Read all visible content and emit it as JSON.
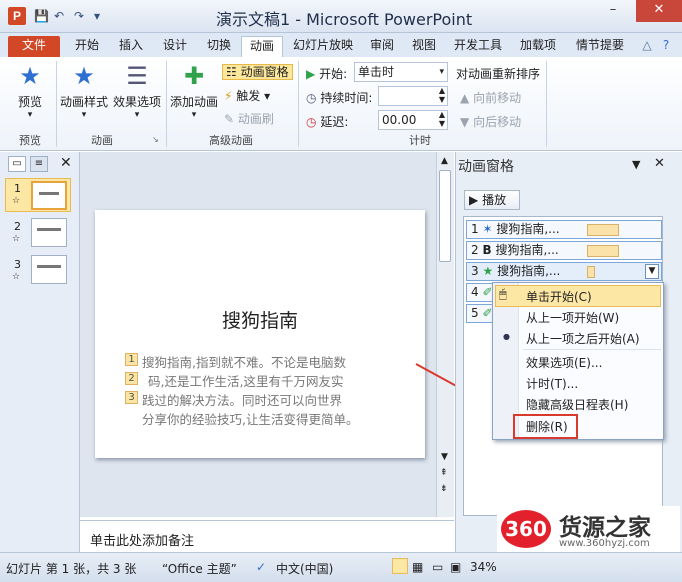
{
  "titlebar": {
    "title": "演示文稿1 - Microsoft PowerPoint",
    "app_icon": "P",
    "qat_save_icon": "save-icon",
    "qat_undo": "↶",
    "qat_redo": "↷",
    "win_min": "–",
    "win_max": "□",
    "win_close": "✕"
  },
  "tabs": [
    "文件",
    "开始",
    "插入",
    "设计",
    "切换",
    "动画",
    "幻灯片放映",
    "审阅",
    "视图",
    "开发工具",
    "加载项",
    "情节提要"
  ],
  "ribbon": {
    "preview": {
      "label": "预览",
      "group": "预览"
    },
    "animation": {
      "style_label": "动画样式",
      "options_label": "效果选项",
      "group": "动画"
    },
    "advanced": {
      "add_label": "添加动画",
      "pane_label": "动画窗格",
      "trigger_label": "触发",
      "painter_label": "动画刷",
      "group": "高级动画"
    },
    "timing": {
      "start_label": "开始:",
      "start_value": "单击时",
      "duration_label": "持续时间:",
      "duration_value": "",
      "delay_label": "延迟:",
      "delay_value": "00.00",
      "group": "计时"
    },
    "reorder": {
      "title": "对动画重新排序",
      "earlier": "向前移动",
      "later": "向后移动"
    }
  },
  "slides": [
    {
      "num": "1"
    },
    {
      "num": "2"
    },
    {
      "num": "3"
    }
  ],
  "slide": {
    "title": "搜狗指南",
    "bullets": [
      {
        "mark": "1",
        "text": "搜狗指南,指到就不难。不论是电脑数"
      },
      {
        "mark": "2",
        "text": "码,还是工作生活,这里有千万网友实"
      },
      {
        "mark": "3",
        "text": "践过的解决方法。同时还可以向世界"
      },
      {
        "mark": "",
        "text": "分享你的经验技巧,让生活变得更简单。"
      }
    ]
  },
  "notes": {
    "placeholder": "单击此处添加备注"
  },
  "anipane": {
    "title": "动画窗格",
    "play_label": "播放",
    "items": [
      {
        "num": "1",
        "icon": "✶",
        "label": "搜狗指南,..."
      },
      {
        "num": "2",
        "icon": "B",
        "label": "搜狗指南,..."
      },
      {
        "num": "3",
        "icon": "★",
        "label": "搜狗指南,..."
      },
      {
        "num": "4",
        "icon": "✐",
        "label": ""
      },
      {
        "num": "5",
        "icon": "✐",
        "label": ""
      }
    ]
  },
  "context_menu": {
    "items": [
      "单击开始(C)",
      "从上一项开始(W)",
      "从上一项之后开始(A)",
      "效果选项(E)...",
      "计时(T)...",
      "隐藏高级日程表(H)",
      "删除(R)"
    ]
  },
  "statusbar": {
    "slide_info": "幻灯片 第 1 张，共 3 张",
    "theme": "“Office 主题”",
    "language": "中文(中国)",
    "zoom": "34%"
  },
  "watermark": {
    "logo": "360",
    "name": "货源之家",
    "url": "www.360hyzj.com"
  },
  "colors": {
    "accent": "#d24726",
    "highlight": "#fde7a4",
    "annotation_red": "#d93a2b"
  }
}
